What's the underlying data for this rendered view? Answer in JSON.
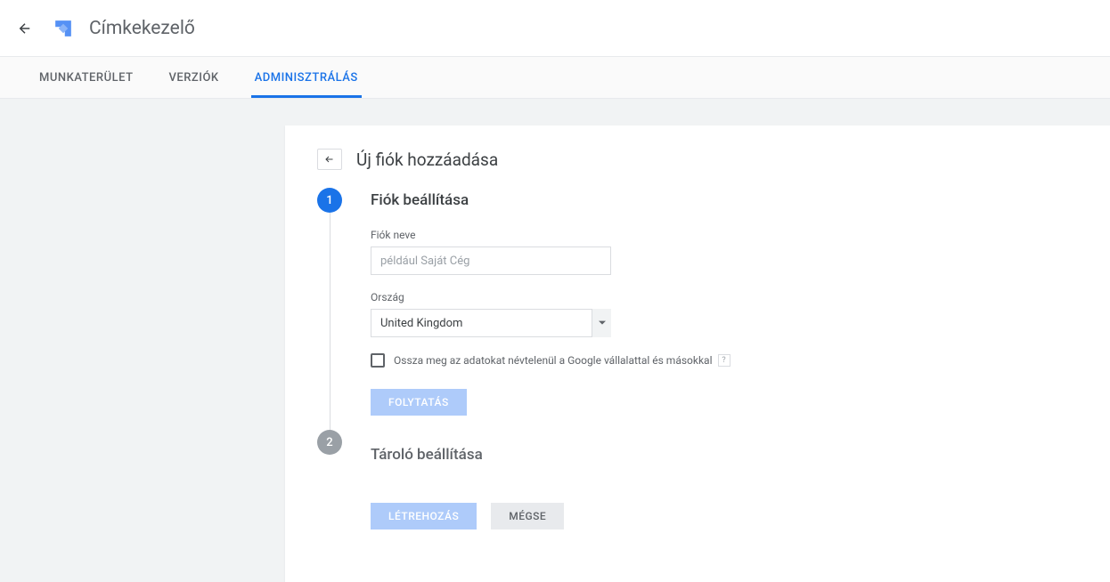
{
  "header": {
    "app_title": "Címkekezelő"
  },
  "tabs": {
    "workspace": "MUNKATERÜLET",
    "versions": "VERZIÓK",
    "admin": "ADMINISZTRÁLÁS"
  },
  "card": {
    "title": "Új fiók hozzáadása"
  },
  "step1": {
    "number": "1",
    "title": "Fiók beállítása",
    "account_name_label": "Fiók neve",
    "account_name_placeholder": "például Saját Cég",
    "country_label": "Ország",
    "country_value": "United Kingdom",
    "share_data_label": "Ossza meg az adatokat névtelenül a Google vállalattal és másokkal",
    "continue_button": "FOLYTATÁS"
  },
  "step2": {
    "number": "2",
    "title": "Tároló beállítása"
  },
  "actions": {
    "create": "LÉTREHOZÁS",
    "cancel": "MÉGSE"
  }
}
